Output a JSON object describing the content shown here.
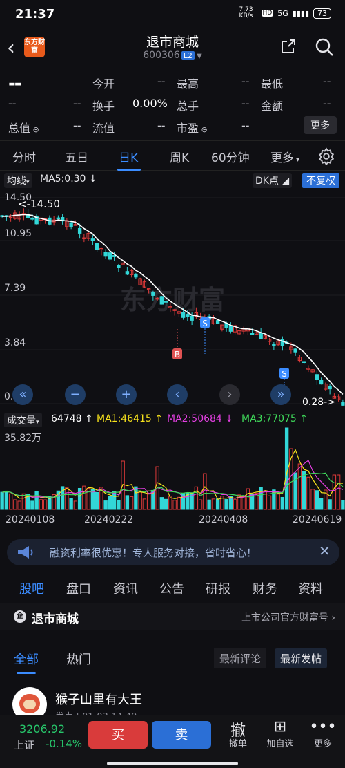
{
  "status": {
    "time": "21:37",
    "speed": "7.73 KB/s",
    "hd": "HD",
    "net": "5G",
    "battery": "73"
  },
  "header": {
    "logo": "东方财富",
    "name": "退市商城",
    "code": "600306",
    "level": "L2"
  },
  "quote": {
    "price": "--",
    "r1": [
      [
        "今开",
        "--"
      ],
      [
        "最高",
        "--"
      ],
      [
        "最低",
        "--"
      ]
    ],
    "r2": [
      [
        "--",
        "--"
      ],
      [
        "换手",
        "0.00%"
      ],
      [
        "总手",
        "--"
      ],
      [
        "金额",
        "--"
      ]
    ],
    "r3": [
      [
        "总值",
        "--"
      ],
      [
        "流值",
        "--"
      ],
      [
        "市盈",
        "--"
      ]
    ],
    "more": "更多"
  },
  "tabs": [
    "分时",
    "五日",
    "日K",
    "周K",
    "60分钟",
    "更多"
  ],
  "active_tab": "日K",
  "chart_bar": {
    "ma_type": "均线",
    "ma5": "MA5:0.30",
    "dk": "DK点",
    "fq": "不复权"
  },
  "kline": {
    "y_ticks": [
      "14.50",
      "10.95",
      "7.39",
      "3.84",
      "0.28"
    ],
    "high_label": "<-14.50",
    "last_label": "0.28->",
    "watermark": "东方财富",
    "markers": [
      {
        "t": "B"
      },
      {
        "t": "S"
      },
      {
        "t": "S"
      }
    ]
  },
  "volume": {
    "label": "成交量",
    "value": "64748",
    "ma1": "MA1:46415",
    "ma2": "MA2:50684",
    "ma3": "MA3:77075",
    "max": "35.82万",
    "dates": [
      "20240108",
      "20240222",
      "20240408",
      "20240619"
    ]
  },
  "ad": {
    "text": "融资利率很优惠！专人服务对接，省时省心！"
  },
  "sub_tabs": [
    "股吧",
    "盘口",
    "资讯",
    "公告",
    "研报",
    "财务",
    "资料"
  ],
  "bar_row": {
    "name": "退市商城",
    "right": "上市公司官方财富号"
  },
  "feed": {
    "tabs": [
      "全部",
      "热门"
    ],
    "sort": [
      "最新评论",
      "最新发帖"
    ]
  },
  "post": {
    "user": "猴子山里有大王",
    "time": "发表于01-03 14:49"
  },
  "bottom": {
    "index_value": "3206.92",
    "index_name": "上证",
    "index_change": "-0.14%",
    "buy": "买",
    "sell": "卖",
    "cancel": "撤",
    "cancel_label": "撤单",
    "add_label": "加自选",
    "more_label": "更多"
  },
  "colors": {
    "up": "#e03a3a",
    "down": "#32d7d8",
    "accent": "#3b8cff"
  }
}
